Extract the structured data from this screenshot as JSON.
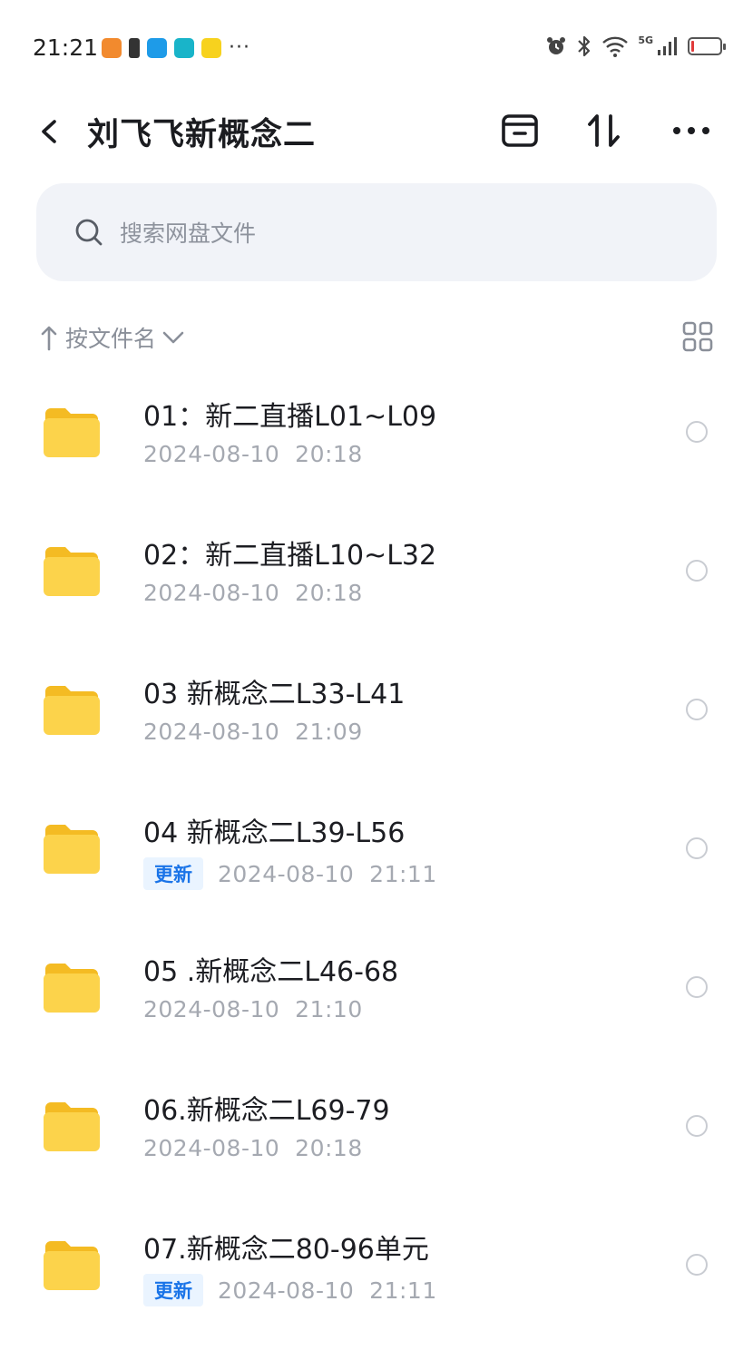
{
  "status_bar": {
    "time": "21:21",
    "network": "5G",
    "notification_icons": [
      "app-orange-icon",
      "battery-saver-icon",
      "reader-app-icon",
      "boss-app-icon",
      "xianyu-app-icon"
    ],
    "more": "···"
  },
  "header": {
    "title": "刘飞飞新概念二"
  },
  "search": {
    "placeholder": "搜索网盘文件"
  },
  "sort": {
    "label": "按文件名"
  },
  "files": [
    {
      "name": "01：新二直播L01~L09",
      "date": "2024-08-10  20:18",
      "badge": ""
    },
    {
      "name": "02：新二直播L10~L32",
      "date": "2024-08-10  20:18",
      "badge": ""
    },
    {
      "name": "03 新概念二L33-L41",
      "date": "2024-08-10  21:09",
      "badge": ""
    },
    {
      "name": "04 新概念二L39-L56",
      "date": "2024-08-10  21:11",
      "badge": "更新"
    },
    {
      "name": "05 .新概念二L46-68",
      "date": "2024-08-10  21:10",
      "badge": ""
    },
    {
      "name": "06.新概念二L69-79",
      "date": "2024-08-10  20:18",
      "badge": ""
    },
    {
      "name": "07.新概念二80-96单元",
      "date": "2024-08-10  21:11",
      "badge": "更新"
    }
  ],
  "colors": {
    "folder": "#fbd24a",
    "badge_text": "#1a74e8",
    "search_bg": "#f1f3f8"
  }
}
